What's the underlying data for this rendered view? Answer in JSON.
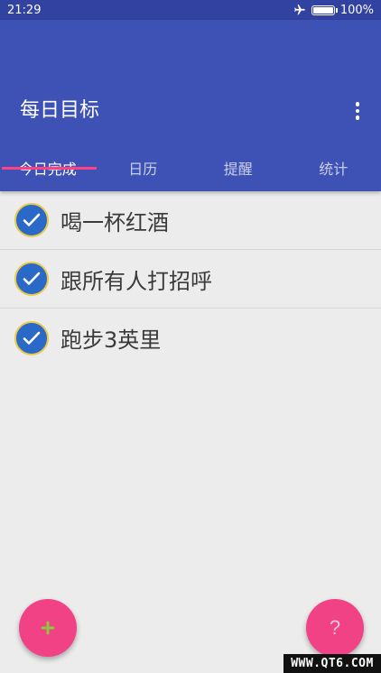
{
  "status_bar": {
    "time": "21:29",
    "battery_percent": "100%",
    "icons": [
      "airplane-icon",
      "battery-icon"
    ]
  },
  "app_bar": {
    "title": "每日目标",
    "background_color": "#3e51b5",
    "menu_icon": "more-vert-icon"
  },
  "tabs": [
    {
      "label": "今日完成",
      "active": true
    },
    {
      "label": "日历",
      "active": false
    },
    {
      "label": "提醒",
      "active": false
    },
    {
      "label": "统计",
      "active": false
    }
  ],
  "tasks": [
    {
      "label": "喝一杯红酒",
      "completed": true
    },
    {
      "label": "跟所有人打招呼",
      "completed": true
    },
    {
      "label": "跑步3英里",
      "completed": true
    }
  ],
  "fabs": {
    "add": {
      "icon": "plus-icon",
      "color": "#f04284"
    },
    "help": {
      "label": "?",
      "icon": "question-icon",
      "color": "#f04284"
    }
  },
  "watermark": "WWW.QT6.COM",
  "colors": {
    "accent": "#ff4081",
    "check_fill": "#2a69c7",
    "check_ring": "#e9c94a"
  }
}
